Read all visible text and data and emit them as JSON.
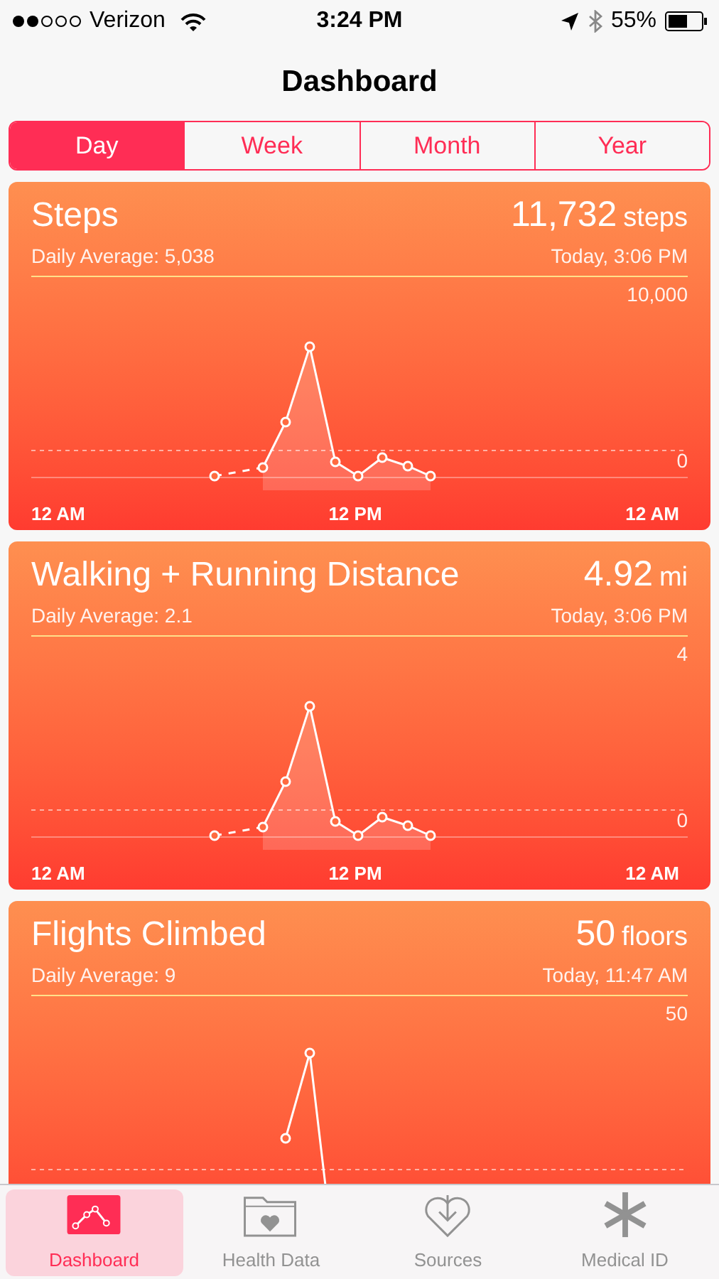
{
  "status_bar": {
    "carrier": "Verizon",
    "time": "3:24 PM",
    "battery": "55%"
  },
  "title": "Dashboard",
  "segments": [
    {
      "label": "Day",
      "selected": true
    },
    {
      "label": "Week",
      "selected": false
    },
    {
      "label": "Month",
      "selected": false
    },
    {
      "label": "Year",
      "selected": false
    }
  ],
  "cards": [
    {
      "title": "Steps",
      "value": "11,732",
      "unit": "steps",
      "average": "Daily Average: 5,038",
      "time": "Today, 3:06 PM",
      "max_label": "10,000",
      "min_label": "0",
      "x_labels": [
        "12 AM",
        "12 PM",
        "12 AM"
      ]
    },
    {
      "title": "Walking + Running Distance",
      "value": "4.92",
      "unit": "mi",
      "average": "Daily Average: 2.1",
      "time": "Today, 3:06 PM",
      "max_label": "4",
      "min_label": "0",
      "x_labels": [
        "12 AM",
        "12 PM",
        "12 AM"
      ]
    },
    {
      "title": "Flights Climbed",
      "value": "50",
      "unit": "floors",
      "average": "Daily Average: 9",
      "time": "Today, 11:47 AM",
      "max_label": "50"
    }
  ],
  "tabs": [
    {
      "label": "Dashboard",
      "kind": "dashboard",
      "selected": true
    },
    {
      "label": "Health Data",
      "kind": "health",
      "selected": false
    },
    {
      "label": "Sources",
      "kind": "sources",
      "selected": false
    },
    {
      "label": "Medical ID",
      "kind": "medical",
      "selected": false
    }
  ]
}
